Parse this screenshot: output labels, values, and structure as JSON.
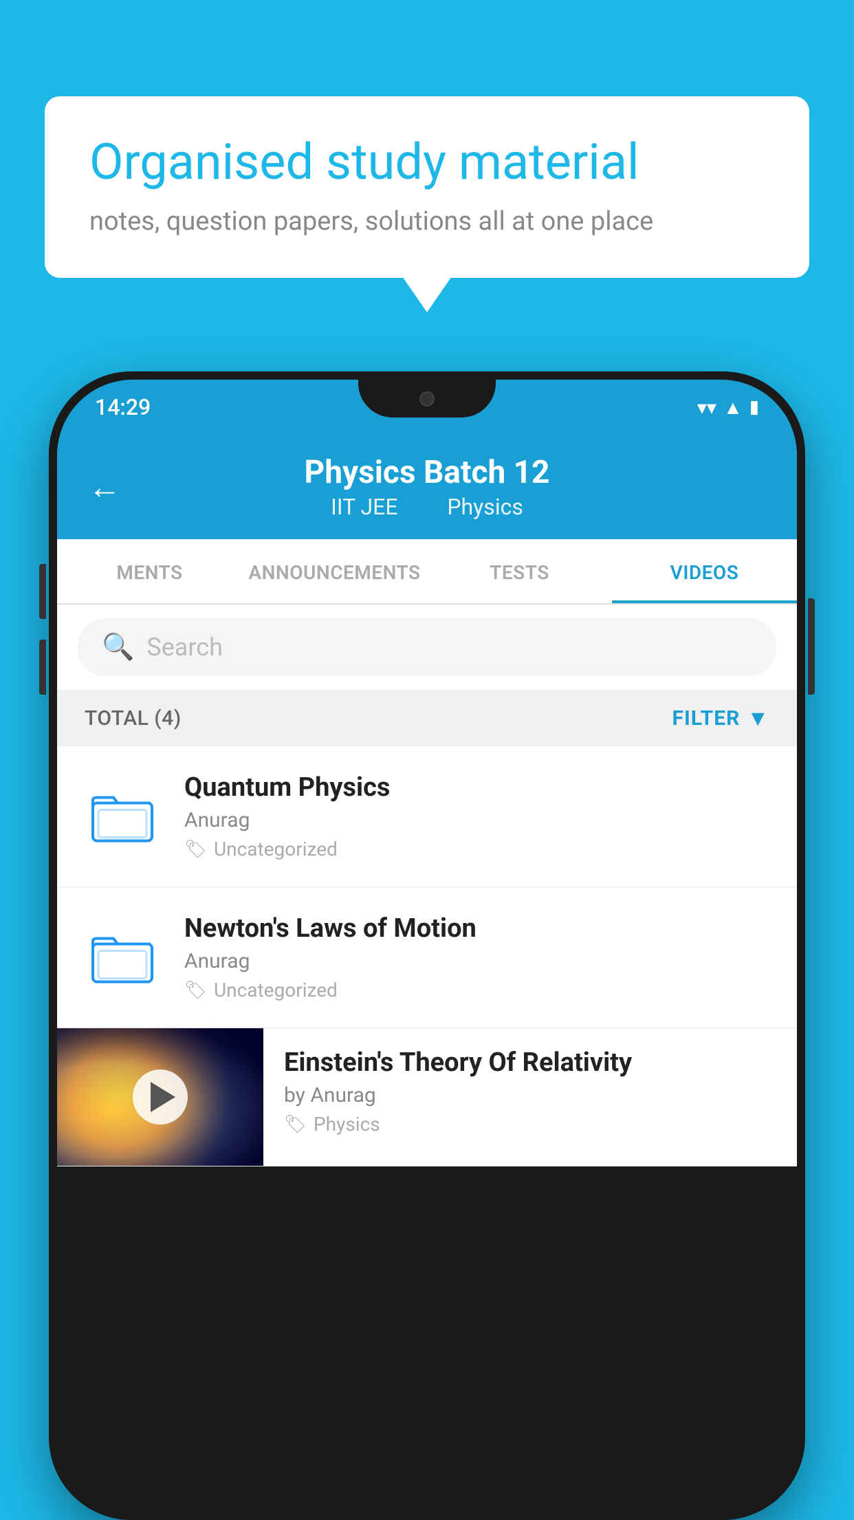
{
  "background_color": "#1DB8E8",
  "speech_bubble": {
    "title": "Organised study material",
    "subtitle": "notes, question papers, solutions all at one place"
  },
  "phone": {
    "status_bar": {
      "time": "14:29",
      "icons": [
        "wifi",
        "signal",
        "battery"
      ]
    },
    "app_header": {
      "back_label": "←",
      "title": "Physics Batch 12",
      "subtitle_parts": [
        "IIT JEE",
        "Physics"
      ]
    },
    "tabs": [
      {
        "label": "MENTS",
        "active": false
      },
      {
        "label": "ANNOUNCEMENTS",
        "active": false
      },
      {
        "label": "TESTS",
        "active": false
      },
      {
        "label": "VIDEOS",
        "active": true
      }
    ],
    "search": {
      "placeholder": "Search"
    },
    "filter_bar": {
      "total_label": "TOTAL (4)",
      "filter_label": "FILTER"
    },
    "items": [
      {
        "type": "folder",
        "title": "Quantum Physics",
        "author": "Anurag",
        "tag": "Uncategorized"
      },
      {
        "type": "folder",
        "title": "Newton's Laws of Motion",
        "author": "Anurag",
        "tag": "Uncategorized"
      },
      {
        "type": "video",
        "title": "Einstein's Theory Of Relativity",
        "author": "by Anurag",
        "tag": "Physics"
      }
    ]
  }
}
